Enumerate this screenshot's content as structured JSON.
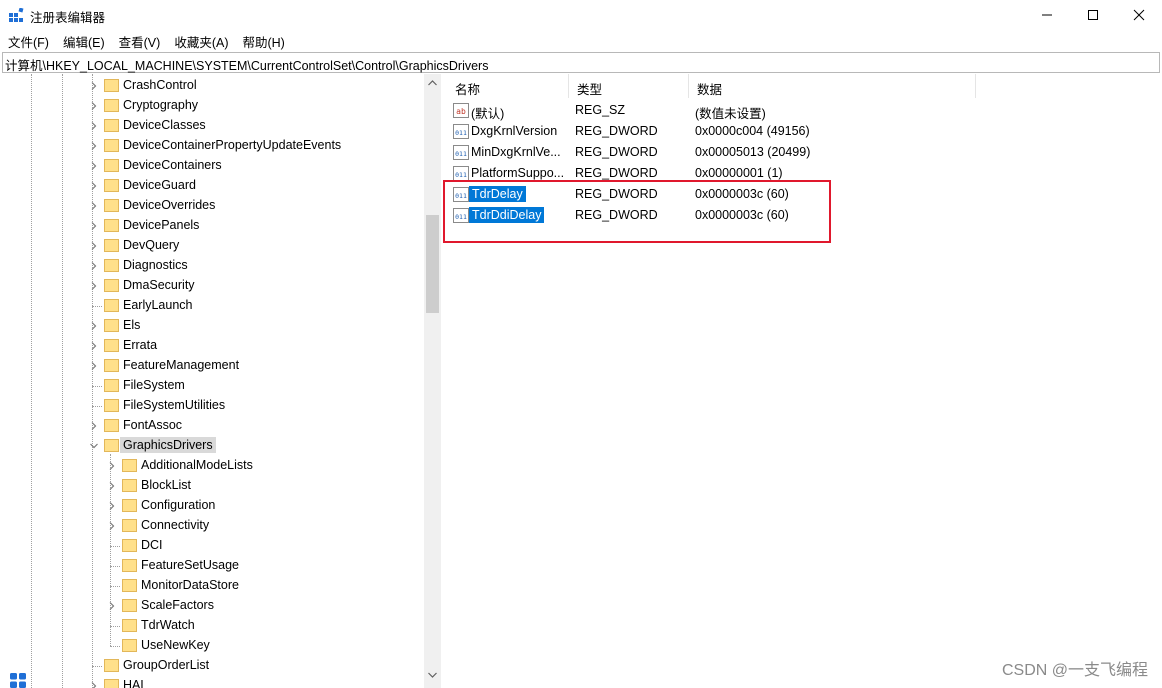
{
  "window": {
    "title": "注册表编辑器",
    "controls": {
      "minimize": "minimize-icon",
      "maximize": "maximize-icon",
      "close": "close-icon"
    }
  },
  "menu": [
    "文件(F)",
    "编辑(E)",
    "查看(V)",
    "收藏夹(A)",
    "帮助(H)"
  ],
  "address": "计算机\\HKEY_LOCAL_MACHINE\\SYSTEM\\CurrentControlSet\\Control\\GraphicsDrivers",
  "tree": {
    "items": [
      {
        "label": "CrashControl",
        "expandable": true
      },
      {
        "label": "Cryptography",
        "expandable": true
      },
      {
        "label": "DeviceClasses",
        "expandable": true
      },
      {
        "label": "DeviceContainerPropertyUpdateEvents",
        "expandable": true
      },
      {
        "label": "DeviceContainers",
        "expandable": true
      },
      {
        "label": "DeviceGuard",
        "expandable": true
      },
      {
        "label": "DeviceOverrides",
        "expandable": true
      },
      {
        "label": "DevicePanels",
        "expandable": true
      },
      {
        "label": "DevQuery",
        "expandable": true
      },
      {
        "label": "Diagnostics",
        "expandable": true
      },
      {
        "label": "DmaSecurity",
        "expandable": true
      },
      {
        "label": "EarlyLaunch",
        "expandable": false
      },
      {
        "label": "Els",
        "expandable": true
      },
      {
        "label": "Errata",
        "expandable": true
      },
      {
        "label": "FeatureManagement",
        "expandable": true
      },
      {
        "label": "FileSystem",
        "expandable": false
      },
      {
        "label": "FileSystemUtilities",
        "expandable": false
      },
      {
        "label": "FontAssoc",
        "expandable": true
      },
      {
        "label": "GraphicsDrivers",
        "expandable": true,
        "expanded": true,
        "selected": true
      },
      {
        "label": "AdditionalModeLists",
        "expandable": true,
        "child": true
      },
      {
        "label": "BlockList",
        "expandable": true,
        "child": true
      },
      {
        "label": "Configuration",
        "expandable": true,
        "child": true
      },
      {
        "label": "Connectivity",
        "expandable": true,
        "child": true
      },
      {
        "label": "DCI",
        "expandable": false,
        "child": true
      },
      {
        "label": "FeatureSetUsage",
        "expandable": false,
        "child": true
      },
      {
        "label": "MonitorDataStore",
        "expandable": false,
        "child": true
      },
      {
        "label": "ScaleFactors",
        "expandable": true,
        "child": true
      },
      {
        "label": "TdrWatch",
        "expandable": false,
        "child": true
      },
      {
        "label": "UseNewKey",
        "expandable": false,
        "child": true
      },
      {
        "label": "GroupOrderList",
        "expandable": false
      },
      {
        "label": "HAL",
        "expandable": true
      }
    ]
  },
  "values_table": {
    "columns": [
      "名称",
      "类型",
      "数据"
    ],
    "rows": [
      {
        "icon": "string-value-icon",
        "name": "(默认)",
        "type": "REG_SZ",
        "data": "(数值未设置)",
        "selected": false
      },
      {
        "icon": "dword-value-icon",
        "name": "DxgKrnlVersion",
        "type": "REG_DWORD",
        "data": "0x0000c004 (49156)",
        "selected": false
      },
      {
        "icon": "dword-value-icon",
        "name": "MinDxgKrnlVe...",
        "type": "REG_DWORD",
        "data": "0x00005013 (20499)",
        "selected": false
      },
      {
        "icon": "dword-value-icon",
        "name": "PlatformSuppo...",
        "type": "REG_DWORD",
        "data": "0x00000001 (1)",
        "selected": false
      },
      {
        "icon": "dword-value-icon",
        "name": "TdrDelay",
        "type": "REG_DWORD",
        "data": "0x0000003c (60)",
        "selected": true
      },
      {
        "icon": "dword-value-icon",
        "name": "TdrDdiDelay",
        "type": "REG_DWORD",
        "data": "0x0000003c (60)",
        "selected": true
      }
    ]
  },
  "annotation_color": "#e0182d",
  "selection_color": "#0078d7",
  "watermark": "CSDN @一支飞编程"
}
